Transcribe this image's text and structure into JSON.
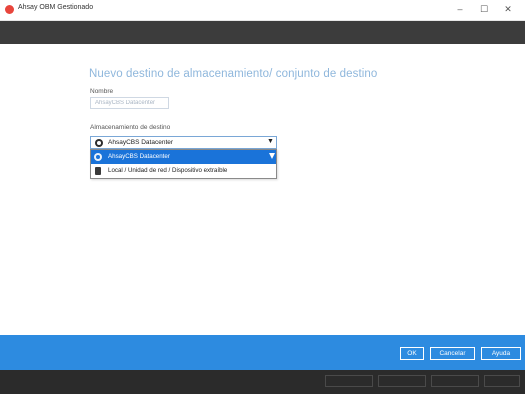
{
  "window": {
    "title": "Ahsay OBM Gestionado",
    "min_label": "–",
    "max_label": "☐",
    "close_label": "✕",
    "app_icon": "app-logo-icon"
  },
  "page": {
    "title": "Nuevo destino de almacenamiento/ conjunto de destino"
  },
  "form": {
    "name_label": "Nombre",
    "name_placeholder": "AhsayCBS Datacenter",
    "storage_label": "Almacenamiento de destino",
    "selected_value": "AhsayCBS Datacenter",
    "options": [
      {
        "label": "AhsayCBS Datacenter",
        "icon": "cloud-icon",
        "selected": true
      },
      {
        "label": "Local / Unidad de red / Dispositivo extraíble",
        "icon": "drive-icon",
        "selected": false
      }
    ]
  },
  "actions": {
    "ok_label": "OK",
    "cancel_label": "Cancelar",
    "help_label": "Ayuda"
  },
  "colors": {
    "accent": "#2d8be0",
    "title_color": "#8fb7dc",
    "header_band": "#3c3c3c",
    "selection": "#1a73d9"
  }
}
